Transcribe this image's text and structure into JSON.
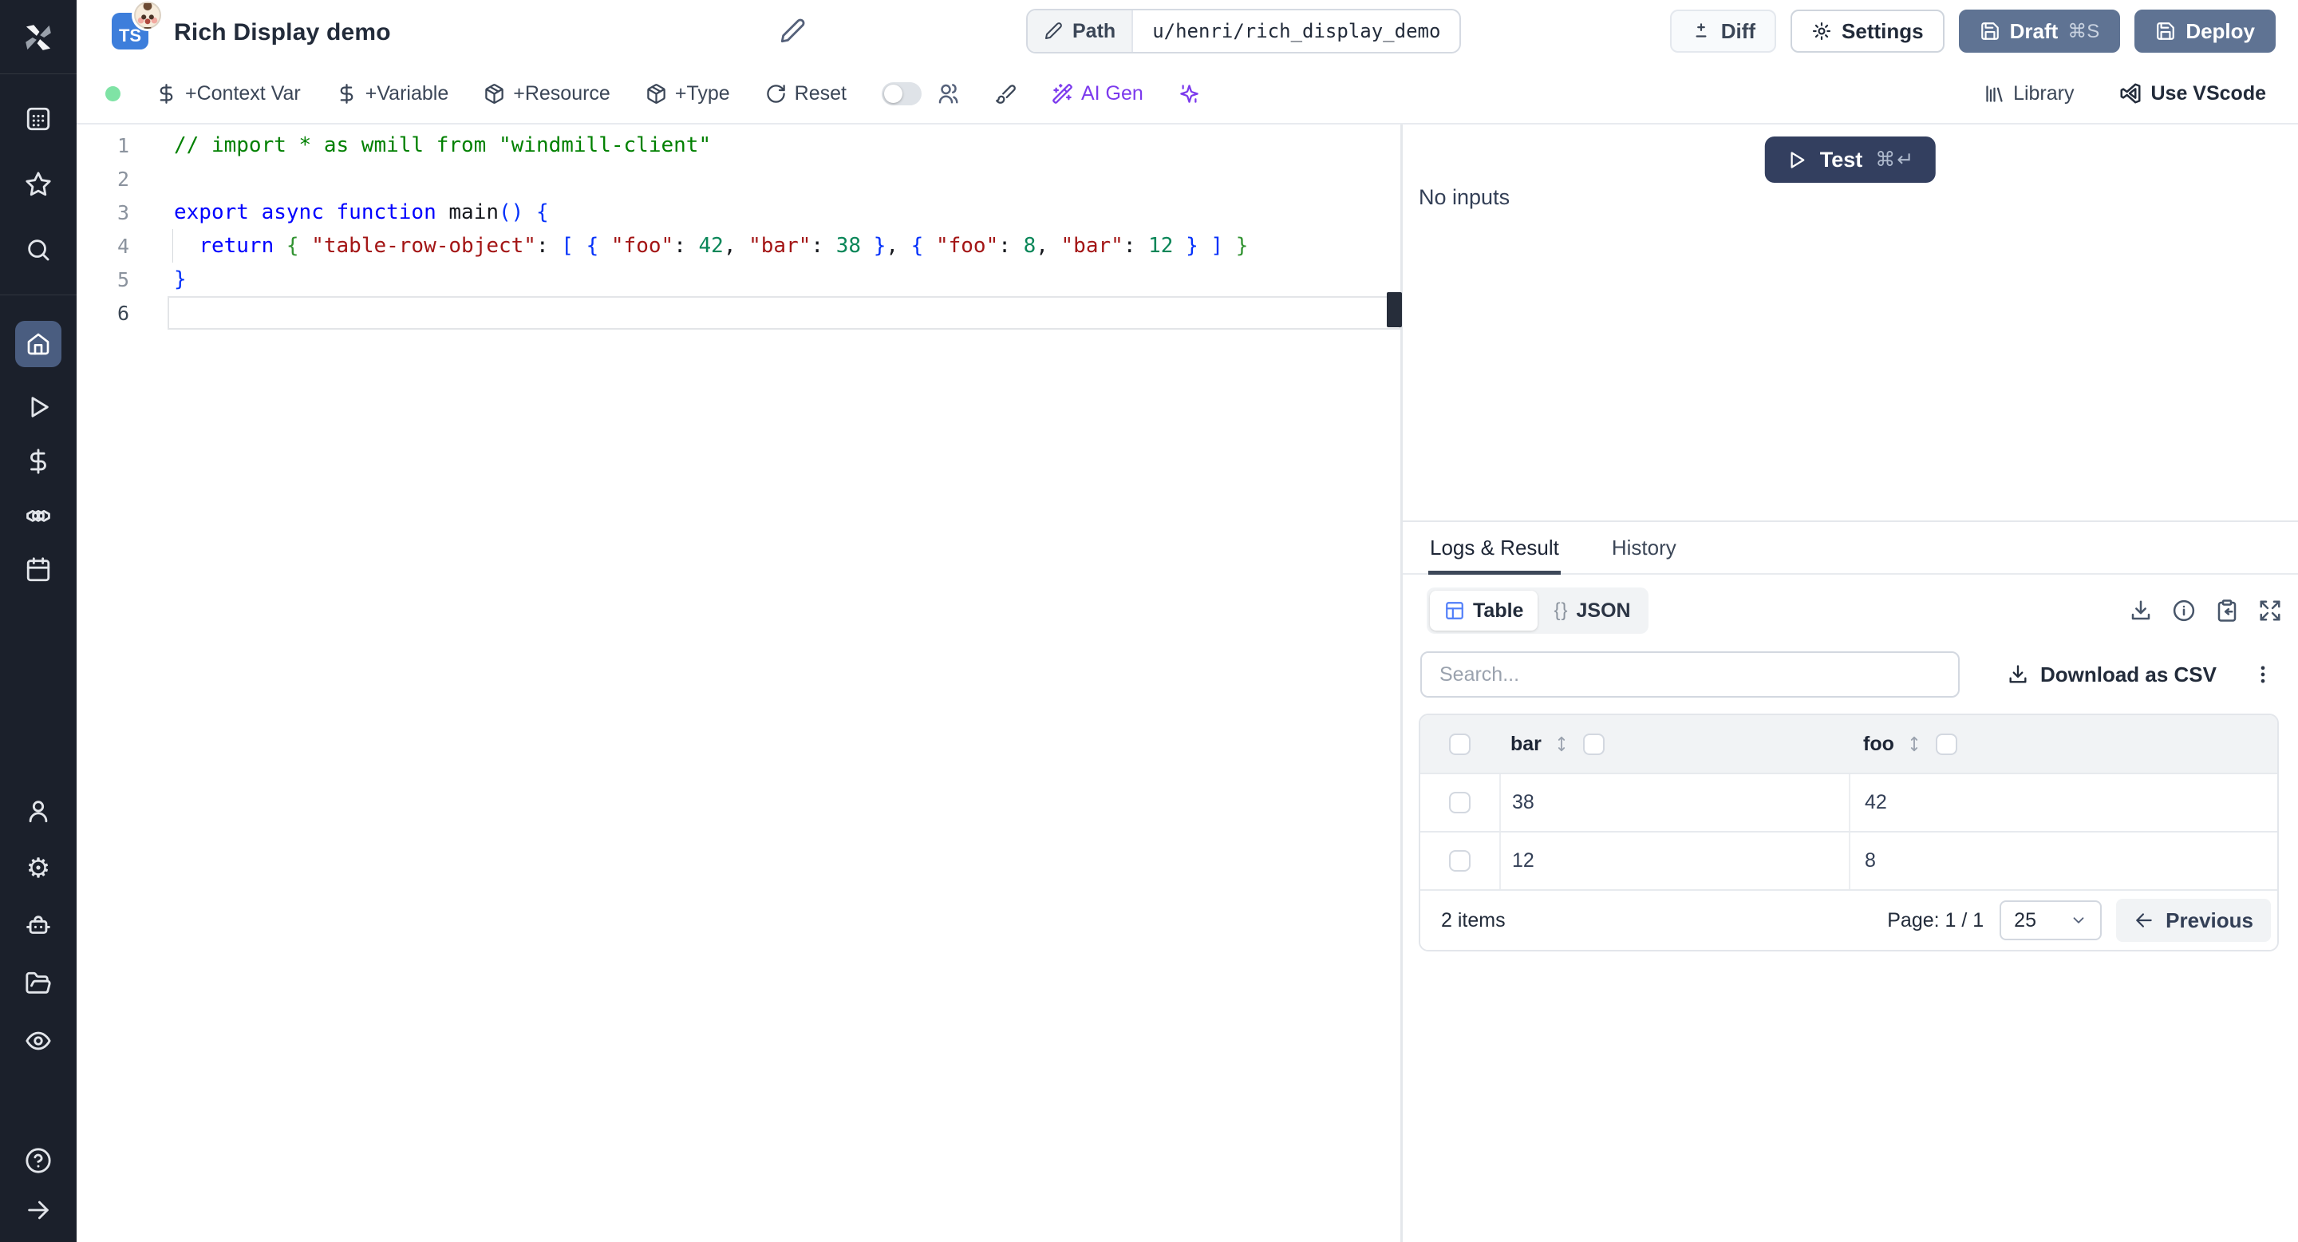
{
  "header": {
    "title": "Rich Display demo",
    "lang_badge": "TS",
    "path_label": "Path",
    "path_value": "u/henri/rich_display_demo",
    "diff_label": "Diff",
    "settings_label": "Settings",
    "draft_label": "Draft",
    "draft_shortcut": "⌘S",
    "deploy_label": "Deploy"
  },
  "toolbar": {
    "context_var": "+Context Var",
    "variable": "+Variable",
    "resource": "+Resource",
    "type": "+Type",
    "reset": "Reset",
    "ai_gen": "AI Gen",
    "library": "Library",
    "use_vscode": "Use VScode"
  },
  "editor": {
    "line_numbers": [
      "1",
      "2",
      "3",
      "4",
      "5",
      "6"
    ],
    "active_line": 6,
    "guide_lines": [
      4
    ],
    "lines": [
      [
        [
          "c",
          "// import * as wmill from \"windmill-client\""
        ]
      ],
      [],
      [
        [
          "k",
          "export"
        ],
        [
          "p",
          " "
        ],
        [
          "k",
          "async"
        ],
        [
          "p",
          " "
        ],
        [
          "k",
          "function"
        ],
        [
          "p",
          " "
        ],
        [
          "id",
          "main"
        ],
        [
          "b1",
          "()"
        ],
        [
          "p",
          " "
        ],
        [
          "b1",
          "{"
        ]
      ],
      [
        [
          "p",
          "  "
        ],
        [
          "k",
          "return"
        ],
        [
          "p",
          " "
        ],
        [
          "b2",
          "{"
        ],
        [
          "p",
          " "
        ],
        [
          "s",
          "\"table-row-object\""
        ],
        [
          "p",
          ": "
        ],
        [
          "b1",
          "["
        ],
        [
          "p",
          " "
        ],
        [
          "b1",
          "{"
        ],
        [
          "p",
          " "
        ],
        [
          "s",
          "\"foo\""
        ],
        [
          "p",
          ": "
        ],
        [
          "n",
          "42"
        ],
        [
          "p",
          ", "
        ],
        [
          "s",
          "\"bar\""
        ],
        [
          "p",
          ": "
        ],
        [
          "n",
          "38"
        ],
        [
          "p",
          " "
        ],
        [
          "b1",
          "}"
        ],
        [
          "p",
          ", "
        ],
        [
          "b1",
          "{"
        ],
        [
          "p",
          " "
        ],
        [
          "s",
          "\"foo\""
        ],
        [
          "p",
          ": "
        ],
        [
          "n",
          "8"
        ],
        [
          "p",
          ", "
        ],
        [
          "s",
          "\"bar\""
        ],
        [
          "p",
          ": "
        ],
        [
          "n",
          "12"
        ],
        [
          "p",
          " "
        ],
        [
          "b1",
          "}"
        ],
        [
          "p",
          " "
        ],
        [
          "b1",
          "]"
        ],
        [
          "p",
          " "
        ],
        [
          "b2",
          "}"
        ]
      ],
      [
        [
          "b1",
          "}"
        ]
      ],
      []
    ]
  },
  "preview": {
    "test_label": "Test",
    "test_shortcut": "⌘↵",
    "no_inputs": "No inputs"
  },
  "results": {
    "tabs": [
      {
        "label": "Logs & Result",
        "active": true
      },
      {
        "label": "History",
        "active": false
      }
    ],
    "view_toggle": {
      "table_label": "Table",
      "json_glyph": "{}",
      "json_label": "JSON"
    },
    "search_placeholder": "Search...",
    "download_csv_label": "Download as CSV",
    "table": {
      "columns": [
        "bar",
        "foo"
      ],
      "rows": [
        [
          "38",
          "42"
        ],
        [
          "12",
          "8"
        ]
      ],
      "items_count": "2 items",
      "page_label": "Page: 1 / 1",
      "page_size": "25",
      "prev_arrow": "←",
      "prev_label": "Previous"
    }
  },
  "sidebar_icons": [
    "windmill-logo",
    "apps-icon",
    "star-icon",
    "search-icon",
    "home-icon",
    "play-icon",
    "dollar-icon",
    "boxes-icon",
    "calendar-icon",
    "user-icon",
    "gear-icon",
    "robot-icon",
    "folder-icon",
    "eye-icon",
    "help-icon",
    "arrow-right-icon"
  ],
  "colors": {
    "sidebar_bg": "#1b202b",
    "sidebar_active": "#4a5d80",
    "slate_button": "#5f7393",
    "test_button": "#333f5f",
    "ai_purple": "#7c3aed",
    "status_green": "#7fe3a5",
    "ts_blue": "#3d7edb",
    "table_icon_blue": "#4f7df9"
  }
}
